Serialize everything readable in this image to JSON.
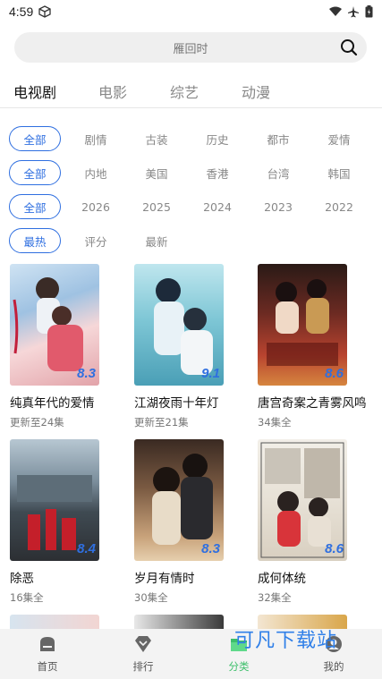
{
  "status": {
    "time": "4:59"
  },
  "search": {
    "text": "雁回时"
  },
  "tabs": [
    {
      "label": "电视剧",
      "active": true
    },
    {
      "label": "电影",
      "active": false
    },
    {
      "label": "综艺",
      "active": false
    },
    {
      "label": "动漫",
      "active": false
    }
  ],
  "filters": [
    {
      "options": [
        "全部",
        "剧情",
        "古装",
        "历史",
        "都市",
        "爱情"
      ],
      "selected": 0
    },
    {
      "options": [
        "全部",
        "内地",
        "美国",
        "香港",
        "台湾",
        "韩国"
      ],
      "selected": 0
    },
    {
      "options": [
        "全部",
        "2026",
        "2025",
        "2024",
        "2023",
        "2022"
      ],
      "selected": 0
    },
    {
      "options": [
        "最热",
        "评分",
        "最新"
      ],
      "selected": 0
    }
  ],
  "cards": [
    {
      "title": "纯真年代的爱情",
      "subtitle": "更新至24集",
      "rating": "8.3"
    },
    {
      "title": "江湖夜雨十年灯",
      "subtitle": "更新至21集",
      "rating": "9.1"
    },
    {
      "title": "唐宫奇案之青雾风鸣",
      "subtitle": "34集全",
      "rating": "8.6"
    },
    {
      "title": "除恶",
      "subtitle": "16集全",
      "rating": "8.4"
    },
    {
      "title": "岁月有情时",
      "subtitle": "30集全",
      "rating": "8.3"
    },
    {
      "title": "成何体统",
      "subtitle": "32集全",
      "rating": "8.6"
    }
  ],
  "nav": [
    {
      "label": "首页",
      "icon": "home-icon",
      "active": false
    },
    {
      "label": "排行",
      "icon": "diamond-icon",
      "active": false
    },
    {
      "label": "分类",
      "icon": "folder-icon",
      "active": true
    },
    {
      "label": "我的",
      "icon": "user-icon",
      "active": false
    }
  ],
  "watermark": "可凡下载站",
  "colors": {
    "accent": "#2f6fe0",
    "nav_active": "#3cbf6a"
  }
}
